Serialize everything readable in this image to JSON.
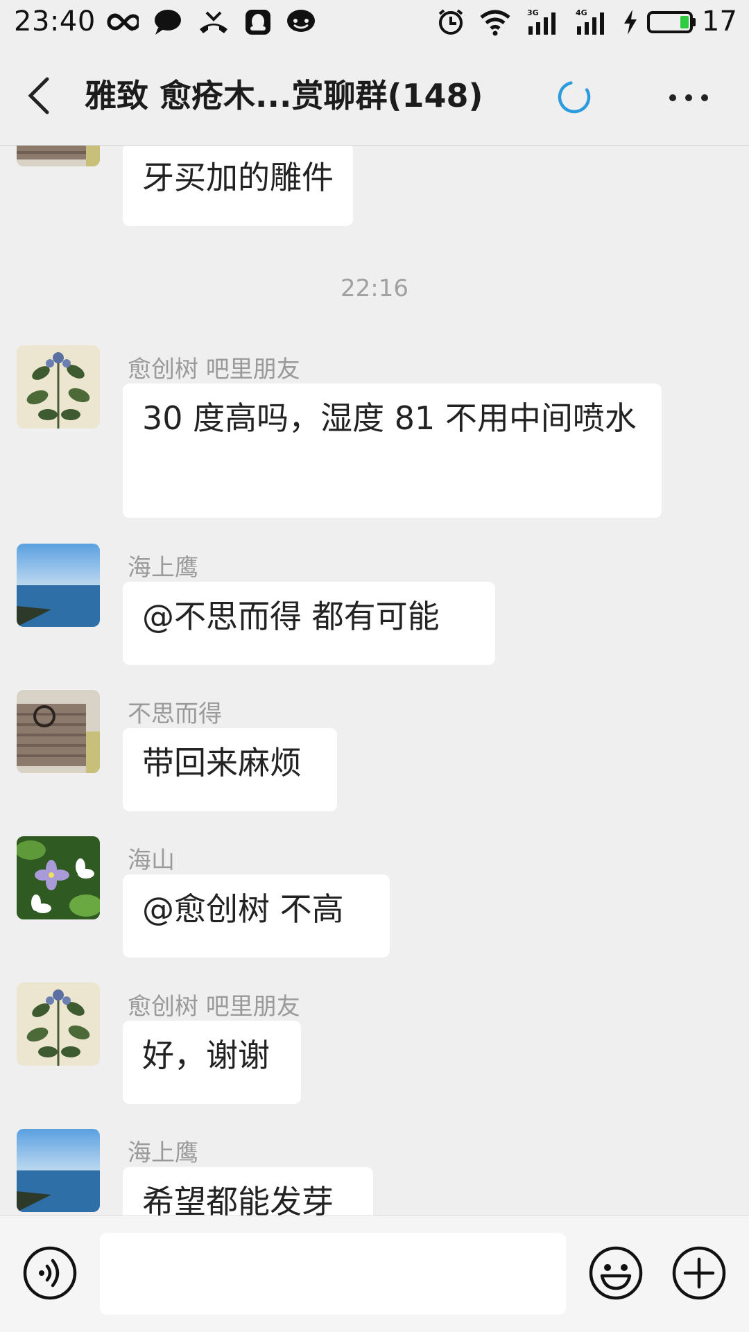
{
  "status_bar": {
    "time": "23:40",
    "battery_level": "17",
    "icons": [
      "infinity-icon",
      "chat-bubble-icon",
      "missed-call-icon",
      "qq-icon",
      "message-icon",
      "alarm-icon",
      "wifi-icon",
      "signal-3g-icon",
      "signal-4g-icon",
      "charging-icon",
      "battery-icon"
    ],
    "net_3g": "3G",
    "net_4g": "4G"
  },
  "header": {
    "title": "雅致  愈疮木...赏聊群(148)",
    "accent_color": "#2b9bdc"
  },
  "messages": [
    {
      "sender": "",
      "text": "牙买加的雕件",
      "avatar": "carving-avatar"
    },
    {
      "timestamp": "22:16"
    },
    {
      "sender": "愈创树  吧里朋友",
      "text": "30 度高吗，湿度 81 不用中间喷水",
      "avatar": "plant-sketch-avatar"
    },
    {
      "sender": "海上鹰",
      "text": "@不思而得  都有可能",
      "avatar": "sea-avatar"
    },
    {
      "sender": "不思而得",
      "text": "带回来麻烦",
      "avatar": "carving-avatar"
    },
    {
      "sender": "海山",
      "text": "@愈创树  不高",
      "avatar": "flower-avatar"
    },
    {
      "sender": "愈创树  吧里朋友",
      "text": "好，谢谢",
      "avatar": "plant-sketch-avatar"
    },
    {
      "sender": "海上鹰",
      "text": "希望都能发芽",
      "avatar": "sea-avatar"
    }
  ],
  "input_bar": {
    "placeholder": "",
    "value": ""
  }
}
